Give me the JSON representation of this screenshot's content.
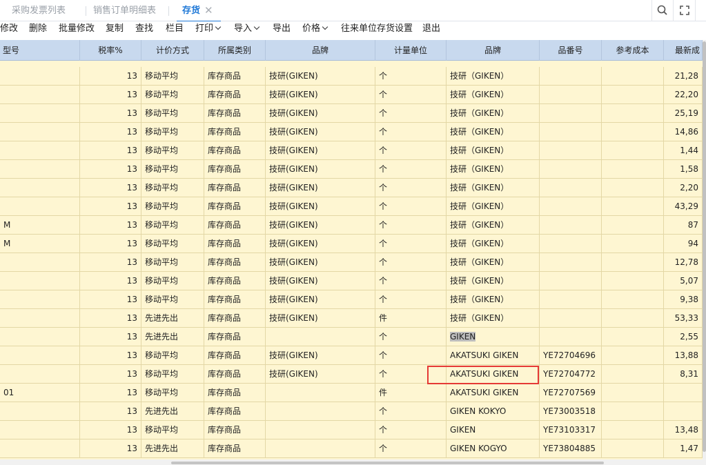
{
  "tabs": [
    {
      "label": "采购发票列表",
      "active": false
    },
    {
      "label": "销售订单明细表",
      "active": false
    },
    {
      "label": "存货",
      "active": true
    }
  ],
  "tab_close_glyph": "✕",
  "window_icons": [
    "search-icon",
    "fullscreen-icon"
  ],
  "toolbar": {
    "items": [
      {
        "label": "修改"
      },
      {
        "label": "删除"
      },
      {
        "label": "批量修改"
      },
      {
        "label": "复制"
      },
      {
        "label": "查找"
      },
      {
        "label": "栏目"
      },
      {
        "label": "打印",
        "dropdown": true
      },
      {
        "label": "导入",
        "dropdown": true
      },
      {
        "label": "导出"
      },
      {
        "label": "价格",
        "dropdown": true
      },
      {
        "label": "往来单位存货设置"
      },
      {
        "label": "退出"
      }
    ]
  },
  "grid": {
    "columns": [
      "型号",
      "税率%",
      "计价方式",
      "所属类别",
      "品牌",
      "计量单位",
      "品牌",
      "品番号",
      "参考成本",
      "最新成"
    ],
    "rows": [
      {
        "model": "",
        "tax": "13",
        "method": "移动平均",
        "category": "库存商品",
        "brand": "技研(GIKEN)",
        "unit": "个",
        "brand2": "技研（GIKEN）",
        "part_no": "",
        "ref_cost": "",
        "latest_cost": "21,28"
      },
      {
        "model": "",
        "tax": "13",
        "method": "移动平均",
        "category": "库存商品",
        "brand": "技研(GIKEN)",
        "unit": "个",
        "brand2": "技研（GIKEN）",
        "part_no": "",
        "ref_cost": "",
        "latest_cost": "22,20"
      },
      {
        "model": "",
        "tax": "13",
        "method": "移动平均",
        "category": "库存商品",
        "brand": "技研(GIKEN)",
        "unit": "个",
        "brand2": "技研（GIKEN）",
        "part_no": "",
        "ref_cost": "",
        "latest_cost": "25,19"
      },
      {
        "model": "",
        "tax": "13",
        "method": "移动平均",
        "category": "库存商品",
        "brand": "技研(GIKEN)",
        "unit": "个",
        "brand2": "技研（GIKEN）",
        "part_no": "",
        "ref_cost": "",
        "latest_cost": "14,86"
      },
      {
        "model": "",
        "tax": "13",
        "method": "移动平均",
        "category": "库存商品",
        "brand": "技研(GIKEN)",
        "unit": "个",
        "brand2": "技研（GIKEN）",
        "part_no": "",
        "ref_cost": "",
        "latest_cost": "1,44"
      },
      {
        "model": "",
        "tax": "13",
        "method": "移动平均",
        "category": "库存商品",
        "brand": "技研(GIKEN)",
        "unit": "个",
        "brand2": "技研（GIKEN）",
        "part_no": "",
        "ref_cost": "",
        "latest_cost": "1,58"
      },
      {
        "model": "",
        "tax": "13",
        "method": "移动平均",
        "category": "库存商品",
        "brand": "技研(GIKEN)",
        "unit": "个",
        "brand2": "技研（GIKEN）",
        "part_no": "",
        "ref_cost": "",
        "latest_cost": "2,20"
      },
      {
        "model": "",
        "tax": "13",
        "method": "移动平均",
        "category": "库存商品",
        "brand": "技研(GIKEN)",
        "unit": "个",
        "brand2": "技研（GIKEN）",
        "part_no": "",
        "ref_cost": "",
        "latest_cost": "43,29"
      },
      {
        "model": "M",
        "tax": "13",
        "method": "移动平均",
        "category": "库存商品",
        "brand": "技研(GIKEN)",
        "unit": "个",
        "brand2": "技研（GIKEN）",
        "part_no": "",
        "ref_cost": "",
        "latest_cost": "87"
      },
      {
        "model": "M",
        "tax": "13",
        "method": "移动平均",
        "category": "库存商品",
        "brand": "技研(GIKEN)",
        "unit": "个",
        "brand2": "技研（GIKEN）",
        "part_no": "",
        "ref_cost": "",
        "latest_cost": "94"
      },
      {
        "model": "",
        "tax": "13",
        "method": "移动平均",
        "category": "库存商品",
        "brand": "技研(GIKEN)",
        "unit": "个",
        "brand2": "技研（GIKEN）",
        "part_no": "",
        "ref_cost": "",
        "latest_cost": "12,78"
      },
      {
        "model": "",
        "tax": "13",
        "method": "移动平均",
        "category": "库存商品",
        "brand": "技研(GIKEN)",
        "unit": "个",
        "brand2": "技研（GIKEN）",
        "part_no": "",
        "ref_cost": "",
        "latest_cost": "5,07"
      },
      {
        "model": "",
        "tax": "13",
        "method": "移动平均",
        "category": "库存商品",
        "brand": "技研(GIKEN)",
        "unit": "个",
        "brand2": "技研（GIKEN）",
        "part_no": "",
        "ref_cost": "",
        "latest_cost": "9,38"
      },
      {
        "model": "",
        "tax": "13",
        "method": "先进先出",
        "category": "库存商品",
        "brand": "技研(GIKEN)",
        "unit": "件",
        "brand2": "技研（GIKEN）",
        "part_no": "",
        "ref_cost": "",
        "latest_cost": "53,33"
      },
      {
        "model": "",
        "tax": "13",
        "method": "先进先出",
        "category": "库存商品",
        "brand": "",
        "unit": "个",
        "brand2": "GIKEN",
        "part_no": "",
        "ref_cost": "",
        "latest_cost": "2,55",
        "selected": true
      },
      {
        "model": "",
        "tax": "13",
        "method": "移动平均",
        "category": "库存商品",
        "brand": "技研(GIKEN)",
        "unit": "个",
        "brand2": "AKATSUKI GIKEN",
        "part_no": "YE72704696",
        "ref_cost": "",
        "latest_cost": "13,88"
      },
      {
        "model": "",
        "tax": "13",
        "method": "移动平均",
        "category": "库存商品",
        "brand": "技研(GIKEN)",
        "unit": "个",
        "brand2": "AKATSUKI GIKEN",
        "part_no": "YE72704772",
        "ref_cost": "",
        "latest_cost": "8,31"
      },
      {
        "model": "01",
        "tax": "13",
        "method": "移动平均",
        "category": "库存商品",
        "brand": "",
        "unit": "件",
        "brand2": "AKATSUKI GIKEN",
        "part_no": "YE72707569",
        "ref_cost": "",
        "latest_cost": ""
      },
      {
        "model": "",
        "tax": "13",
        "method": "先进先出",
        "category": "库存商品",
        "brand": "",
        "unit": "个",
        "brand2": "GIKEN KOKYO",
        "part_no": "YE73003518",
        "ref_cost": "",
        "latest_cost": ""
      },
      {
        "model": "",
        "tax": "13",
        "method": "移动平均",
        "category": "库存商品",
        "brand": "",
        "unit": "个",
        "brand2": "GIKEN",
        "part_no": "YE73103317",
        "ref_cost": "",
        "latest_cost": "13,48"
      },
      {
        "model": "",
        "tax": "13",
        "method": "先进先出",
        "category": "库存商品",
        "brand": "",
        "unit": "个",
        "brand2": "GIKEN KOGYO",
        "part_no": "YE73804885",
        "ref_cost": "",
        "latest_cost": "1,47"
      }
    ]
  },
  "colors": {
    "active_tab": "#1e78d7",
    "grid_bg": "#fef6d2",
    "header_bg": "#c8d9ee",
    "selection_border": "#e53935"
  }
}
